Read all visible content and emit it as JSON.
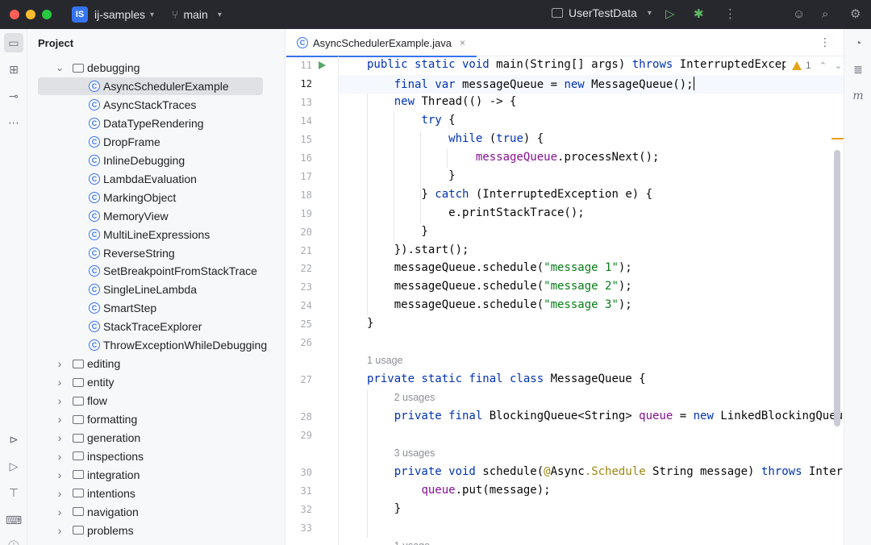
{
  "titlebar": {
    "project_badge": "IS",
    "project_name": "ij-samples",
    "branch": "main",
    "run_config": "UserTestData",
    "colors": {
      "bg": "#27282e",
      "badge": "#3574f0"
    }
  },
  "project_panel": {
    "title": "Project",
    "tree": [
      {
        "label": "debugging",
        "kind": "folder",
        "expanded": true
      },
      {
        "label": "AsyncSchedulerExample",
        "kind": "class",
        "selected": true
      },
      {
        "label": "AsyncStackTraces",
        "kind": "class"
      },
      {
        "label": "DataTypeRendering",
        "kind": "class"
      },
      {
        "label": "DropFrame",
        "kind": "class"
      },
      {
        "label": "InlineDebugging",
        "kind": "class"
      },
      {
        "label": "LambdaEvaluation",
        "kind": "class"
      },
      {
        "label": "MarkingObject",
        "kind": "class"
      },
      {
        "label": "MemoryView",
        "kind": "class"
      },
      {
        "label": "MultiLineExpressions",
        "kind": "class"
      },
      {
        "label": "ReverseString",
        "kind": "class"
      },
      {
        "label": "SetBreakpointFromStackTrace",
        "kind": "class"
      },
      {
        "label": "SingleLineLambda",
        "kind": "class"
      },
      {
        "label": "SmartStep",
        "kind": "class"
      },
      {
        "label": "StackTraceExplorer",
        "kind": "class"
      },
      {
        "label": "ThrowExceptionWhileDebugging",
        "kind": "class"
      },
      {
        "label": "editing",
        "kind": "folder"
      },
      {
        "label": "entity",
        "kind": "folder"
      },
      {
        "label": "flow",
        "kind": "folder"
      },
      {
        "label": "formatting",
        "kind": "folder"
      },
      {
        "label": "generation",
        "kind": "folder"
      },
      {
        "label": "inspections",
        "kind": "folder"
      },
      {
        "label": "integration",
        "kind": "folder"
      },
      {
        "label": "intentions",
        "kind": "folder"
      },
      {
        "label": "navigation",
        "kind": "folder"
      },
      {
        "label": "problems",
        "kind": "folder"
      }
    ]
  },
  "editor": {
    "tab_label": "AsyncSchedulerExample.java",
    "tab_close": "×",
    "warning_count": "1",
    "lines": [
      {
        "num": "11",
        "run": true,
        "html": "<span class=\"kw\">public static void</span> main(String[] args) <span class=\"kw\">throws</span> InterruptedExcep"
      },
      {
        "num": "12",
        "current": true,
        "html": "    <span class=\"kw\">final var</span> messageQueue = <span class=\"kw\">new</span> MessageQueue();<span class=\"caret-cursor\"></span>"
      },
      {
        "num": "13",
        "html": "    <span class=\"kw\">new</span> Thread(() -> {"
      },
      {
        "num": "14",
        "html": "        <span class=\"kw\">try</span> {"
      },
      {
        "num": "15",
        "html": "            <span class=\"kw\">while</span> (<span class=\"kw\">true</span>) {"
      },
      {
        "num": "16",
        "html": "                <span class=\"fld\">messageQueue</span>.processNext();"
      },
      {
        "num": "17",
        "html": "            }"
      },
      {
        "num": "18",
        "html": "        } <span class=\"kw\">catch</span> (InterruptedException e) {"
      },
      {
        "num": "19",
        "html": "            e.printStackTrace();"
      },
      {
        "num": "20",
        "html": "        }"
      },
      {
        "num": "21",
        "html": "    }).start();"
      },
      {
        "num": "22",
        "html": "    messageQueue.schedule(<span class=\"str\">\"message 1\"</span>);"
      },
      {
        "num": "23",
        "html": "    messageQueue.schedule(<span class=\"str\">\"message 2\"</span>);"
      },
      {
        "num": "24",
        "html": "    messageQueue.schedule(<span class=\"str\">\"message 3\"</span>);"
      },
      {
        "num": "25",
        "html": "}"
      },
      {
        "num": "26",
        "html": ""
      },
      {
        "hint": "1 usage",
        "indent": 0
      },
      {
        "num": "27",
        "html": "<span class=\"kw\">private static final class</span> MessageQueue {"
      },
      {
        "hint": "2 usages",
        "indent": 1
      },
      {
        "num": "28",
        "html": "    <span class=\"kw\">private final</span> BlockingQueue&lt;String&gt; <span class=\"fld\">queue</span> = <span class=\"kw\">new</span> LinkedBlockingQueue"
      },
      {
        "num": "29",
        "html": ""
      },
      {
        "hint": "3 usages",
        "indent": 1
      },
      {
        "num": "30",
        "html": "    <span class=\"kw\">private void</span> schedule(<span class=\"ann\">@</span>Async<span class=\"ann\">.Schedule</span> String message) <span class=\"kw\">throws</span> Interr"
      },
      {
        "num": "31",
        "html": "        <span class=\"fld\">queue</span>.put(message);"
      },
      {
        "num": "32",
        "html": "    }"
      },
      {
        "num": "33",
        "html": ""
      },
      {
        "hint": "1 usage",
        "indent": 1
      }
    ]
  }
}
